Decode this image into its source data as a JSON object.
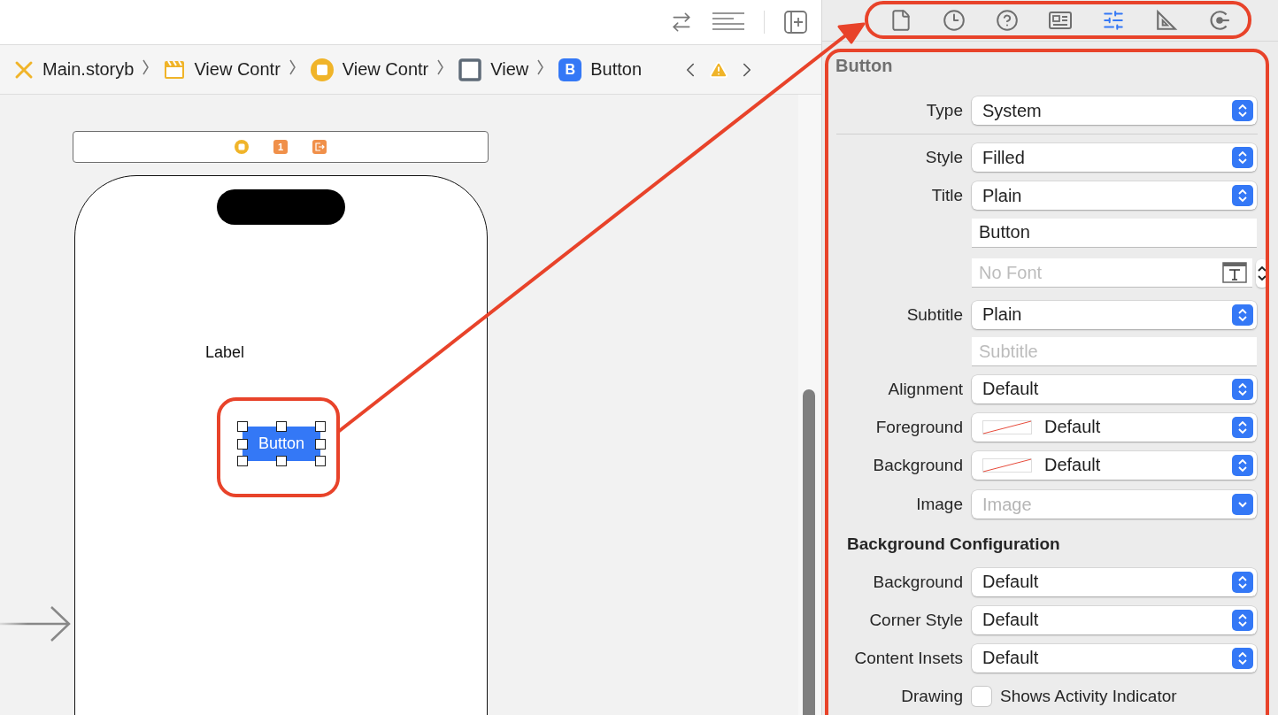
{
  "breadcrumbs": [
    {
      "kind": "storyboard",
      "label": "Main.storyb"
    },
    {
      "kind": "scene",
      "label": "View Contr"
    },
    {
      "kind": "controller",
      "label": "View Contr"
    },
    {
      "kind": "view",
      "label": "View"
    },
    {
      "kind": "button",
      "label": "Button",
      "badge": "B"
    }
  ],
  "canvas": {
    "dock_badge": "1",
    "label": "Label",
    "button": {
      "title": "Button",
      "selected": true
    }
  },
  "inspector": {
    "tabs": [
      {
        "kind": "file",
        "selected": false
      },
      {
        "kind": "history",
        "selected": false
      },
      {
        "kind": "help",
        "selected": false
      },
      {
        "kind": "identity",
        "selected": false
      },
      {
        "kind": "attributes",
        "selected": true
      },
      {
        "kind": "size",
        "selected": false
      },
      {
        "kind": "connections",
        "selected": false
      }
    ],
    "title": "Button",
    "rows": [
      {
        "kind": "popup",
        "label": "Type",
        "value": "System"
      },
      {
        "kind": "divider"
      },
      {
        "kind": "popup",
        "label": "Style",
        "value": "Filled"
      },
      {
        "kind": "popup",
        "label": "Title",
        "value": "Plain"
      },
      {
        "kind": "text",
        "value": "Button"
      },
      {
        "kind": "font",
        "placeholder": "No Font"
      },
      {
        "kind": "popup",
        "label": "Subtitle",
        "value": "Plain"
      },
      {
        "kind": "text",
        "placeholder": "Subtitle"
      },
      {
        "kind": "popup",
        "label": "Alignment",
        "value": "Default"
      },
      {
        "kind": "color",
        "label": "Foreground",
        "value": "Default"
      },
      {
        "kind": "color",
        "label": "Background",
        "value": "Default"
      },
      {
        "kind": "combo",
        "label": "Image",
        "placeholder": "Image"
      },
      {
        "kind": "section",
        "label": "Background Configuration"
      },
      {
        "kind": "popup",
        "label": "Background",
        "value": "Default"
      },
      {
        "kind": "popup",
        "label": "Corner Style",
        "value": "Default"
      },
      {
        "kind": "popup",
        "label": "Content Insets",
        "value": "Default"
      },
      {
        "kind": "checkbox",
        "label": "Drawing",
        "text": "Shows Activity Indicator",
        "checked": false
      }
    ]
  }
}
